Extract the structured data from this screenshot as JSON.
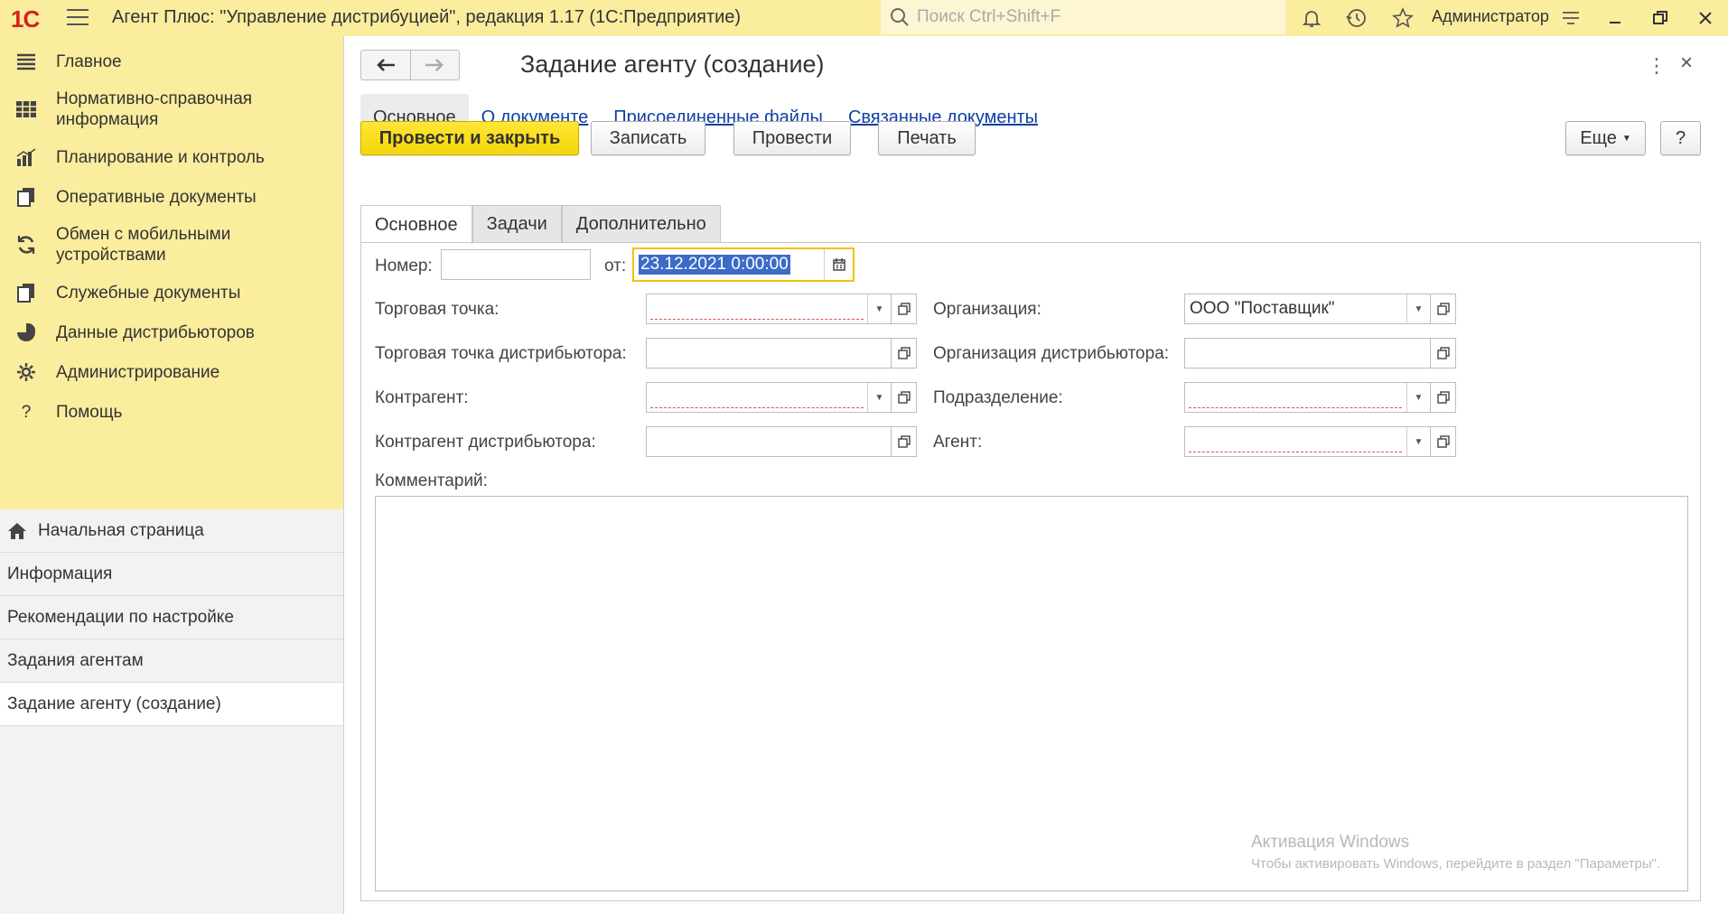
{
  "titlebar": {
    "logo": "1С",
    "app_title": "Агент Плюс: \"Управление дистрибуцией\", редакция 1.17  (1С:Предприятие)",
    "search_placeholder": "Поиск Ctrl+Shift+F",
    "user": "Администратор"
  },
  "sidebar": {
    "sections": [
      {
        "label": "Главное",
        "icon": "list-icon"
      },
      {
        "label": "Нормативно-справочная информация",
        "icon": "table-icon"
      },
      {
        "label": "Планирование и контроль",
        "icon": "bar-chart-icon"
      },
      {
        "label": "Оперативные документы",
        "icon": "documents-icon"
      },
      {
        "label": "Обмен с мобильными устройствами",
        "icon": "sync-icon"
      },
      {
        "label": "Служебные документы",
        "icon": "documents-icon"
      },
      {
        "label": "Данные дистрибьюторов",
        "icon": "pie-icon"
      },
      {
        "label": "Администрирование",
        "icon": "gear-icon"
      },
      {
        "label": "Помощь",
        "icon": "question-icon"
      }
    ],
    "open_windows": [
      {
        "label": "Начальная страница",
        "active": false
      },
      {
        "label": "Информация",
        "active": false
      },
      {
        "label": "Рекомендации по настройке",
        "active": false
      },
      {
        "label": "Задания агентам",
        "active": false
      },
      {
        "label": "Задание агенту (создание)",
        "active": true
      }
    ]
  },
  "form": {
    "title": "Задание агенту (создание)",
    "panel_tabs": [
      "Основное",
      "О документе",
      "Присоединенные файлы",
      "Связанные документы"
    ],
    "buttons": {
      "post_close": "Провести и закрыть",
      "save": "Записать",
      "post": "Провести",
      "print": "Печать",
      "more": "Еще",
      "help": "?"
    },
    "tabs": [
      "Основное",
      "Задачи",
      "Дополнительно"
    ],
    "fields": {
      "number_label": "Номер:",
      "number_value": "",
      "date_label": "от:",
      "date_value": "23.12.2021  0:00:00",
      "trade_point_label": "Торговая точка:",
      "trade_point_value": "",
      "dist_trade_point_label": "Торговая точка дистрибьютора:",
      "dist_trade_point_value": "",
      "counterparty_label": "Контрагент:",
      "counterparty_value": "",
      "dist_counterparty_label": "Контрагент дистрибьютора:",
      "dist_counterparty_value": "",
      "organization_label": "Организация:",
      "organization_value": "ООО \"Поставщик\"",
      "dist_organization_label": "Организация дистрибьютора:",
      "dist_organization_value": "",
      "department_label": "Подразделение:",
      "department_value": "",
      "agent_label": "Агент:",
      "agent_value": "",
      "comment_label": "Комментарий:",
      "comment_value": ""
    }
  },
  "watermark": {
    "line1": "Активация Windows",
    "line2": "Чтобы активировать Windows, перейдите в раздел \"Параметры\"."
  },
  "colors": {
    "accent_yellow": "#fbed9e",
    "primary_button": "#f5d40b",
    "link": "#0f3fa6",
    "required_underline": "#e05050"
  }
}
